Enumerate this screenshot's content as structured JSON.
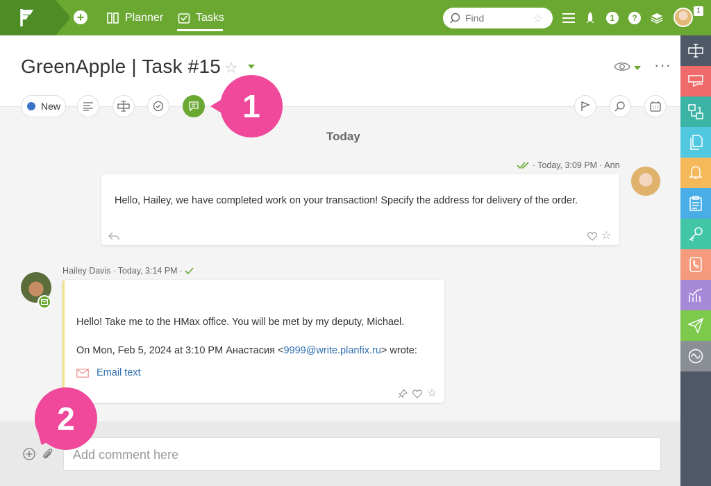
{
  "topbar": {
    "planner_label": "Planner",
    "tasks_label": "Tasks",
    "find_placeholder": "Find",
    "notification_count": "1",
    "accent_color": "#6aa832"
  },
  "task": {
    "title": "GreenApple | Task #15",
    "status": "New",
    "status_color": "#3a74c7"
  },
  "callouts": {
    "one": "1",
    "two": "2"
  },
  "feed": {
    "day_label": "Today",
    "messages": [
      {
        "meta_time": "Today, 3:09 PM",
        "meta_author": "Ann",
        "text": "Hello, Hailey, we have completed work on your transaction! Specify the address for delivery of the order."
      },
      {
        "meta_author": "Hailey Davis",
        "meta_time": "Today, 3:14 PM",
        "text": "Hello! Take me to the HMax office. You will be met by my deputy, Michael.",
        "quote_prefix": "On Mon, Feb 5, 2024 at 3:10 PM Анастасия <",
        "quote_email": "9999@write.planfix.ru",
        "quote_suffix": "> wrote:",
        "email_link": "Email text"
      }
    ]
  },
  "composer": {
    "placeholder": "Add comment here"
  },
  "sidebar_colors": [
    "#4f5866",
    "#ef6a6a",
    "#3bb3a5",
    "#4fc8e0",
    "#f6b95a",
    "#4aaee6",
    "#42c6a6",
    "#f59a7c",
    "#a68ad8",
    "#7cc94b",
    "#8a8f96"
  ]
}
